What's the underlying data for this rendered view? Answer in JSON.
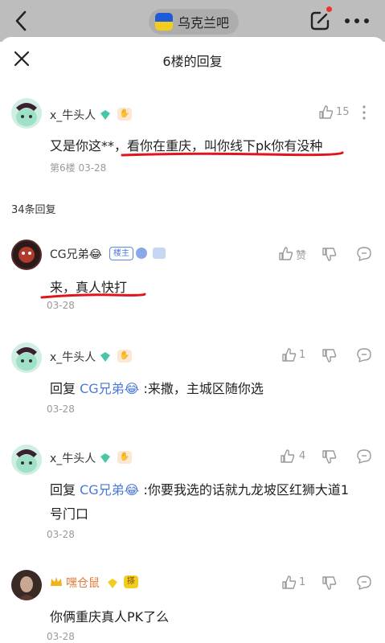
{
  "header": {
    "forum_name": "乌克兰吧"
  },
  "sheet": {
    "title": "6楼的回复"
  },
  "main_post": {
    "username": "x_牛头人",
    "text": "又是你这**，看你在重庆，叫你线下pk你有没种",
    "meta": "第6楼  03-28",
    "likes": "15"
  },
  "replies_label": "34条回复",
  "replies": [
    {
      "username": "CG兄弟😂",
      "host_badge": "楼主",
      "text": "来，真人快打",
      "time": "03-28",
      "like_label": "赞"
    },
    {
      "username": "x_牛头人",
      "reply_prefix": "回复",
      "reply_to": "CG兄弟😂",
      "text": ":来撒，主城区随你选",
      "time": "03-28",
      "likes": "1"
    },
    {
      "username": "x_牛头人",
      "reply_prefix": "回复",
      "reply_to": "CG兄弟😂",
      "text": ":你要我选的话就九龙坡区红狮大道1",
      "text_line2": "号门口",
      "time": "03-28",
      "likes": "4"
    },
    {
      "username": "嘿仓鼠",
      "level_badge": "搽",
      "text": "你俩重庆真人PK了么",
      "time": "03-28",
      "likes": "1"
    }
  ],
  "colors": {
    "accent_blue": "#4a78d6",
    "annotation_red": "#e0141b",
    "gray_text": "#9a9a9a"
  },
  "icons": [
    "back-icon",
    "edit-icon",
    "more-icon",
    "close-icon",
    "thumbs-up-icon",
    "thumbs-down-icon",
    "comment-icon",
    "gem-icon",
    "level-badge",
    "crown-icon"
  ]
}
